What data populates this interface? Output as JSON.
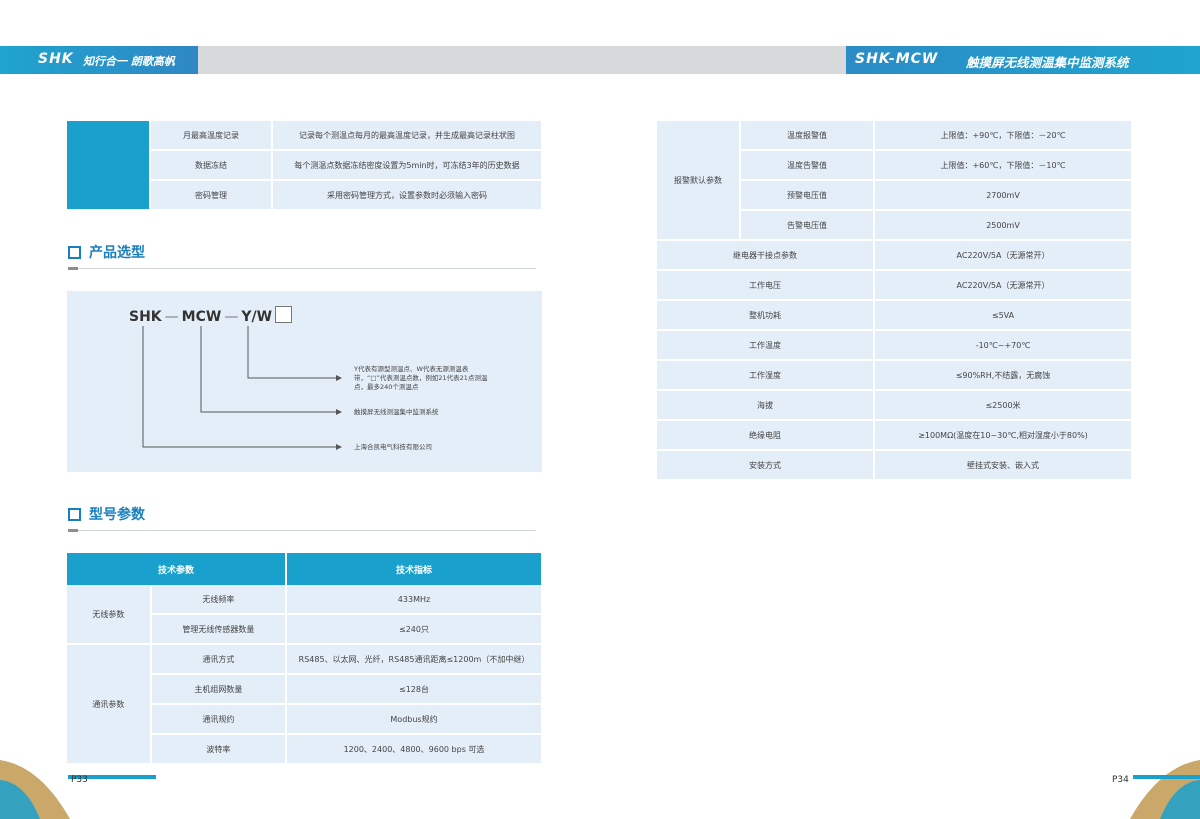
{
  "header": {
    "logo": "SHK",
    "slogan": "知行合一 朗歌高帆",
    "brand_right": "SHK-MCW",
    "title_right": "触摸屏无线测温集中监测系统"
  },
  "colors": {
    "accent": "#1aa0cc",
    "cell": "#e4eef8",
    "heading": "#1a7fbf"
  },
  "top_table": {
    "rows": [
      {
        "name": "月最高温度记录",
        "desc": "记录每个测温点每月的最高温度记录，并生成最高记录柱状图"
      },
      {
        "name": "数据冻结",
        "desc": "每个测温点数据冻结密度设置为5min时，可冻结3年的历史数据"
      },
      {
        "name": "密码管理",
        "desc": "采用密码管理方式，设置参数时必须输入密码"
      }
    ]
  },
  "selection": {
    "title": "产品选型",
    "code_part1": "SHK",
    "dash": "—",
    "code_part2": "MCW",
    "code_part3": "Y/W",
    "note1": "Y代表有源型测温点、W代表无源测温表带，“□”代表测温点数，例如21代表21点测温点，最多240个测温点",
    "note2": "触摸屏无线测温集中监测系统",
    "note3": "上海合凯电气科技有限公司"
  },
  "params": {
    "title": "型号参数",
    "col1": "技术参数",
    "col2": "技术指标",
    "groups": [
      {
        "group": "无线参数",
        "rows": [
          {
            "name": "无线频率",
            "value": "433MHz"
          },
          {
            "name": "管理无线传感器数量",
            "value": "≤240只"
          }
        ]
      },
      {
        "group": "通讯参数",
        "rows": [
          {
            "name": "通讯方式",
            "value": "RS485、以太网、光纤，RS485通讯距离≤1200m（不加中继）"
          },
          {
            "name": "主机组网数量",
            "value": "≤128台"
          },
          {
            "name": "通讯规约",
            "value": "Modbus规约"
          },
          {
            "name": "波特率",
            "value": "1200、2400、4800、9600 bps 可选"
          }
        ]
      }
    ]
  },
  "right_table": {
    "alarm_group": "报警默认参数",
    "alarm_rows": [
      {
        "name": "温度报警值",
        "value": "上限值：+90℃，下限值：－20℃"
      },
      {
        "name": "温度告警值",
        "value": "上限值：+60℃，下限值：－10℃"
      },
      {
        "name": "预警电压值",
        "value": "2700mV"
      },
      {
        "name": "告警电压值",
        "value": "2500mV"
      }
    ],
    "rows": [
      {
        "name": "继电器干接点参数",
        "value": "AC220V/5A（无源常开）"
      },
      {
        "name": "工作电压",
        "value": "AC220V/5A（无源常开）"
      },
      {
        "name": "整机功耗",
        "value": "≤5VA"
      },
      {
        "name": "工作温度",
        "value": "-10℃~+70℃"
      },
      {
        "name": "工作湿度",
        "value": "≤90%RH,不结露，无腐蚀"
      },
      {
        "name": "海拔",
        "value": "≤2500米"
      },
      {
        "name": "绝缘电阻",
        "value": "≥100MΩ(温度在10~30℃,相对湿度小于80%)"
      },
      {
        "name": "安装方式",
        "value": "壁挂式安装、嵌入式"
      }
    ]
  },
  "footer": {
    "left": "P33",
    "right": "P34"
  }
}
